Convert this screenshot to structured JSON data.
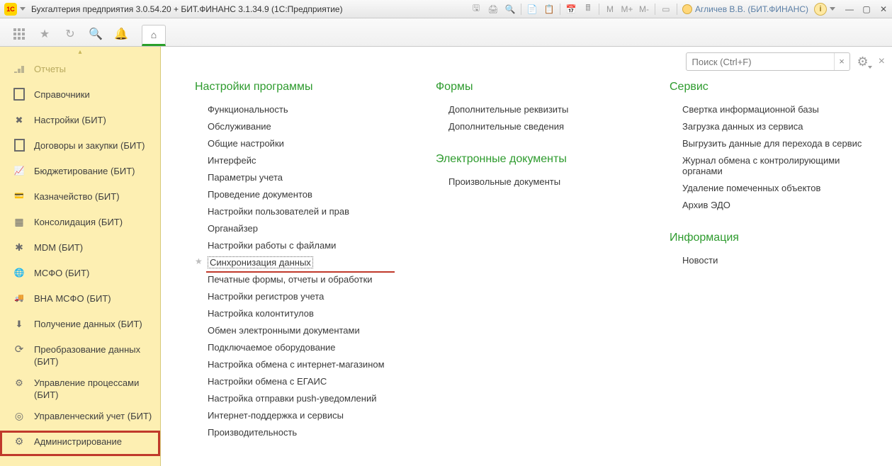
{
  "titlebar": {
    "logo": "1C",
    "title": "Бухгалтерия предприятия 3.0.54.20 + БИТ.ФИНАНС 3.1.34.9  (1С:Предприятие)",
    "m1": "M",
    "m2": "M+",
    "m3": "M-",
    "user": "Агличев В.В. (БИТ.ФИНАНС)",
    "help": "i"
  },
  "search": {
    "placeholder": "Поиск (Ctrl+F)"
  },
  "sidebar": {
    "items": [
      {
        "icon": "i-bars",
        "label": "Отчеты",
        "dim": true
      },
      {
        "icon": "i-book",
        "label": "Справочники"
      },
      {
        "icon": "i-wrench",
        "label": "Настройки (БИТ)"
      },
      {
        "icon": "i-doc",
        "label": "Договоры и закупки (БИТ)"
      },
      {
        "icon": "i-chart",
        "label": "Бюджетирование (БИТ)"
      },
      {
        "icon": "i-wallet",
        "label": "Казначейство (БИТ)"
      },
      {
        "icon": "i-boxes",
        "label": "Консолидация (БИТ)"
      },
      {
        "icon": "i-star",
        "label": "MDM (БИТ)"
      },
      {
        "icon": "i-globe",
        "label": "МСФО (БИТ)"
      },
      {
        "icon": "i-truck",
        "label": "ВНА МСФО (БИТ)"
      },
      {
        "icon": "i-dl",
        "label": "Получение данных (БИТ)"
      },
      {
        "icon": "i-reload",
        "label": "Преобразование данных (БИТ)"
      },
      {
        "icon": "i-flow",
        "label": "Управление процессами (БИТ)"
      },
      {
        "icon": "i-target",
        "label": "Управленческий учет (БИТ)"
      },
      {
        "icon": "i-gear",
        "label": "Администрирование",
        "selected": true
      }
    ]
  },
  "content": {
    "col1_h": "Настройки программы",
    "col1": [
      "Функциональность",
      "Обслуживание",
      "Общие настройки",
      "Интерфейс",
      "Параметры учета",
      "Проведение документов",
      "Настройки пользователей и прав",
      "Органайзер",
      "Настройки работы с файлами",
      "Синхронизация данных",
      "Печатные формы, отчеты и обработки",
      "Настройки регистров учета",
      "Настройка колонтитулов",
      "Обмен электронными документами",
      "Подключаемое оборудование",
      "Настройка обмена с интернет-магазином",
      "Настройки обмена с ЕГАИС",
      "Настройка отправки push-уведомлений",
      "Интернет-поддержка и сервисы",
      "Производительность"
    ],
    "col1_hl_index": 9,
    "col2a_h": "Формы",
    "col2a": [
      "Дополнительные реквизиты",
      "Дополнительные сведения"
    ],
    "col2b_h": "Электронные документы",
    "col2b": [
      "Произвольные документы"
    ],
    "col3a_h": "Сервис",
    "col3a": [
      "Свертка информационной базы",
      "Загрузка данных из сервиса",
      "Выгрузить данные для перехода в сервис",
      "Журнал обмена с контролирующими органами",
      "Удаление помеченных объектов",
      "Архив ЭДО"
    ],
    "col3b_h": "Информация",
    "col3b": [
      "Новости"
    ]
  }
}
